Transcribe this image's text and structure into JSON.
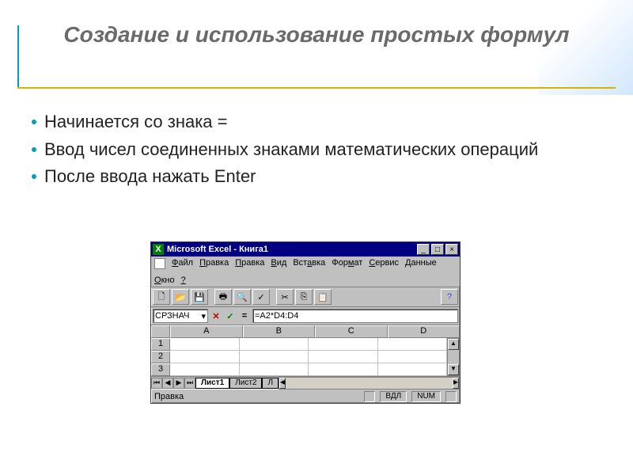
{
  "slide": {
    "title": "Создание и использование простых формул",
    "bullets": [
      "Начинается со знака =",
      "Ввод чисел соединенных знаками математических операций",
      "После ввода нажать Enter"
    ]
  },
  "excel": {
    "title": "Microsoft Excel - Книга1",
    "menus": [
      "Файл",
      "Правка",
      "Правка",
      "Вид",
      "Вставка",
      "Формат",
      "Сервис",
      "Данные",
      "Окно",
      "?"
    ],
    "name_box": "СРЗНАЧ",
    "formula": "=A2*D4:D4",
    "columns": [
      "A",
      "B",
      "C",
      "D"
    ],
    "rows": [
      "1",
      "2",
      "3"
    ],
    "sheet_tabs": [
      "Лист1",
      "Лист2",
      "Л"
    ],
    "status": "Правка",
    "indicators": [
      "ВДЛ",
      "NUM"
    ]
  }
}
